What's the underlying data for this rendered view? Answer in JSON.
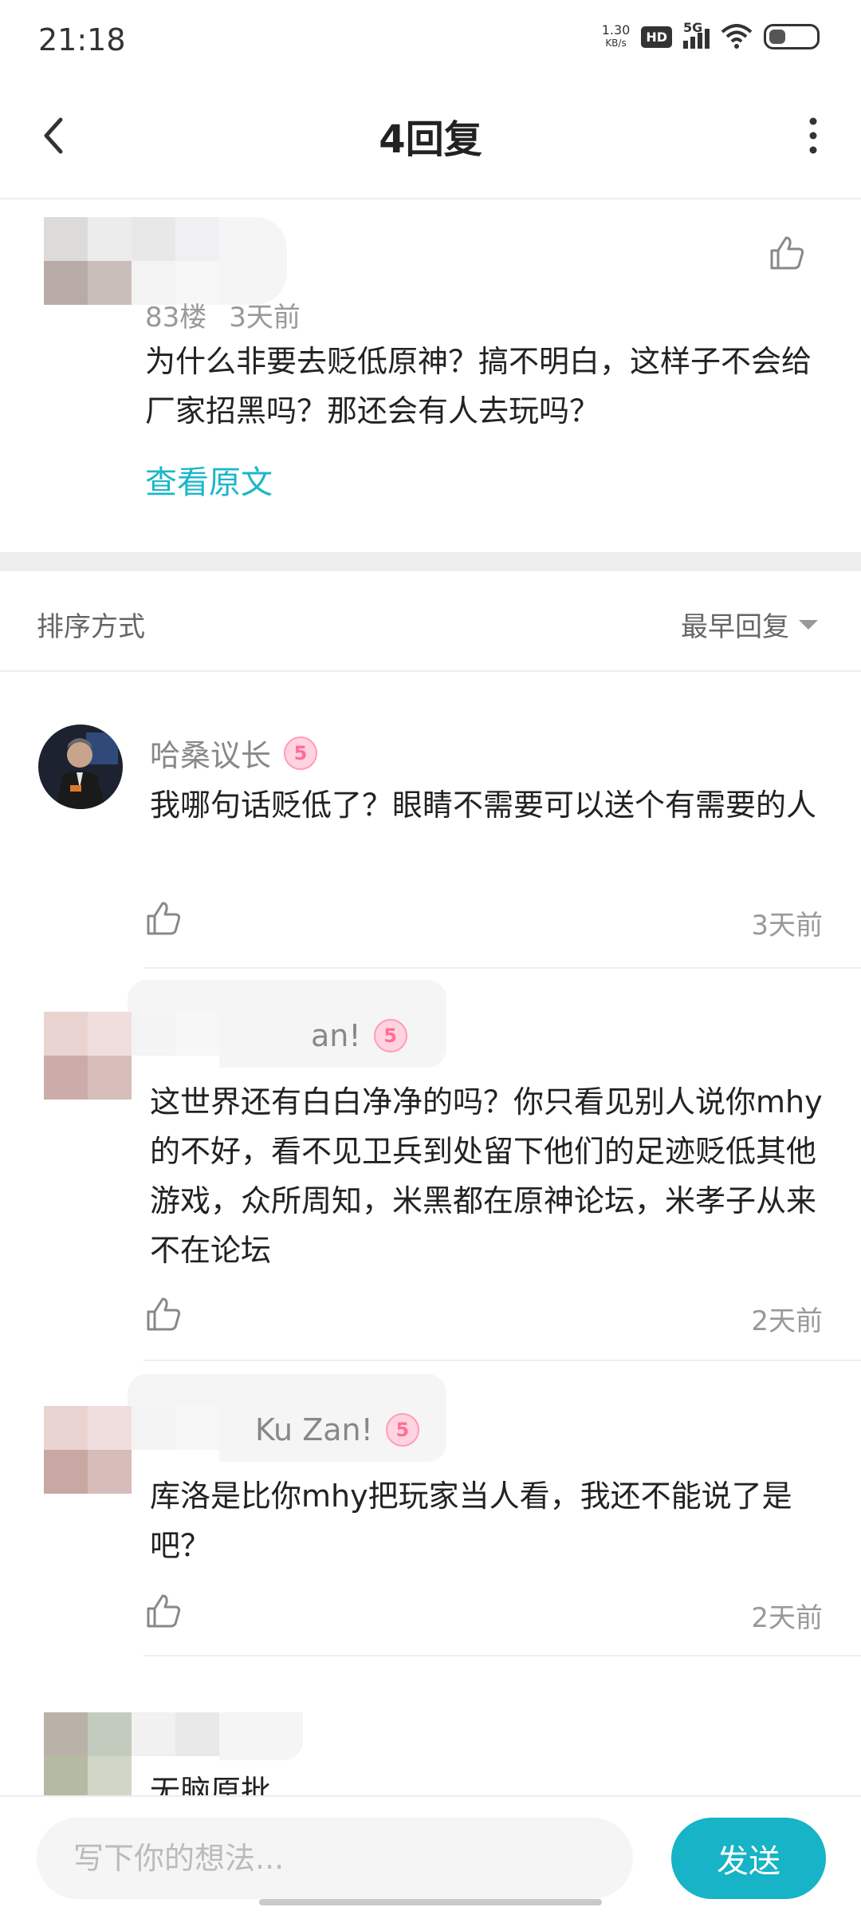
{
  "status_bar": {
    "time": "21:18",
    "net_speed_value": "1.30",
    "net_speed_unit": "KB/s",
    "hd": "HD",
    "network": "5G",
    "battery": "5"
  },
  "header": {
    "title": "4回复"
  },
  "original_post": {
    "floor": "83楼",
    "time": "3天前",
    "text": "为什么非要去贬低原神？搞不明白，这样子不会给厂家招黑吗？那还会有人去玩吗？",
    "view_original": "查看原文"
  },
  "sort": {
    "label": "排序方式",
    "value": "最早回复"
  },
  "replies": [
    {
      "name": "哈桑议长",
      "level": "5",
      "text": "我哪句话贬低了？眼睛不需要可以送个有需要的人",
      "time": "3天前"
    },
    {
      "name": "an!",
      "level": "5",
      "text": "这世界还有白白净净的吗？你只看见别人说你mhy的不好，看不见卫兵到处留下他们的足迹贬低其他游戏，众所周知，米黑都在原神论坛，米孝子从来不在论坛",
      "time": "2天前"
    },
    {
      "name": "Ku Zan!",
      "level": "5",
      "text": "库洛是比你mhy把玩家当人看，我还不能说了是吧？",
      "time": "2天前"
    },
    {
      "name": "",
      "text": "无脑原批",
      "time": ""
    }
  ],
  "composer": {
    "placeholder": "写下你的想法...",
    "send_label": "发送"
  },
  "colors": {
    "accent": "#17b3c6",
    "link": "#1bb7c9",
    "level_badge": "#ff6f93"
  }
}
